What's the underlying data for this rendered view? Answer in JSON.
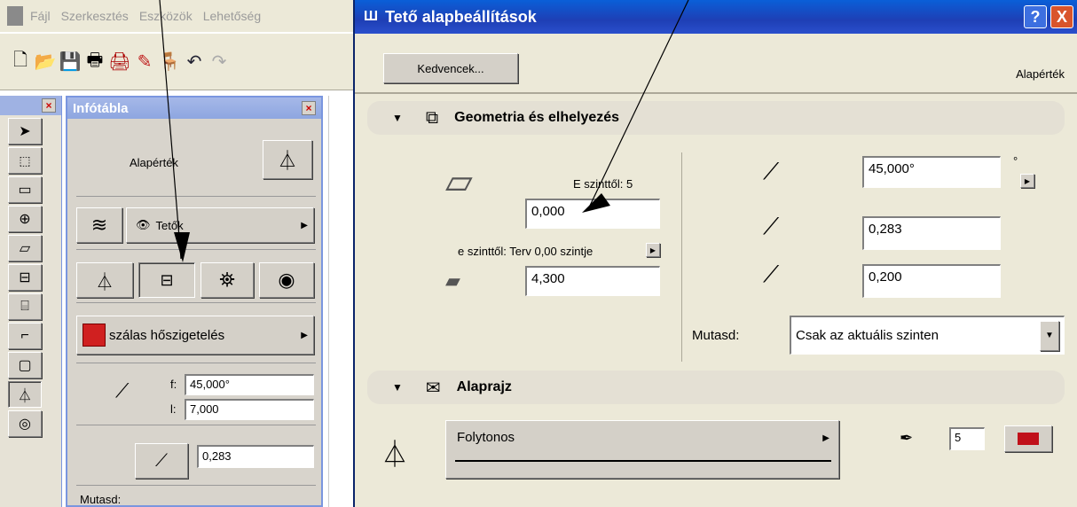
{
  "menubar": {
    "items": [
      "Fájl",
      "Szerkesztés",
      "Eszközök",
      "Lehetőség"
    ]
  },
  "toolbar": {
    "icons": [
      "new-icon",
      "open-icon",
      "save-icon",
      "print-icon",
      "plot-icon",
      "undo-icon"
    ]
  },
  "infopanel": {
    "title": "Infótábla",
    "default_label": "Alapérték",
    "layer_label": "Tetők",
    "material_label": "szálas hőszigetelés",
    "angle_prefix_f": "f:",
    "angle_f": "45,000°",
    "angle_prefix_l": "l:",
    "angle_l": "7,000",
    "thickness": "0,283",
    "show_label": "Mutasd:"
  },
  "dialog": {
    "title": "Tető alapbeállítások",
    "help_label": "?",
    "close_label": "X",
    "favorites_button": "Kedvencek...",
    "default_label": "Alapérték",
    "section_geometry": "Geometria és elhelyezés",
    "from_story_label": "E szinttől: 5",
    "height_value": "0,000",
    "from_ref_label": "e szinttől: Terv 0,00 szintje",
    "base_value": "4,300",
    "slope_value": "45,000°",
    "degree_symbol": "°",
    "thickness_value": "0,283",
    "offset_value": "0,200",
    "show_label": "Mutasd:",
    "show_option": "Csak az aktuális szinten",
    "section_floorplan": "Alaprajz",
    "line_type": "Folytonos",
    "pen_number": "5"
  },
  "colors": {
    "title_blue": "#1e3fb5",
    "close_red": "#d9542b",
    "pen_red": "#c0101a",
    "material_red": "#d02020"
  }
}
